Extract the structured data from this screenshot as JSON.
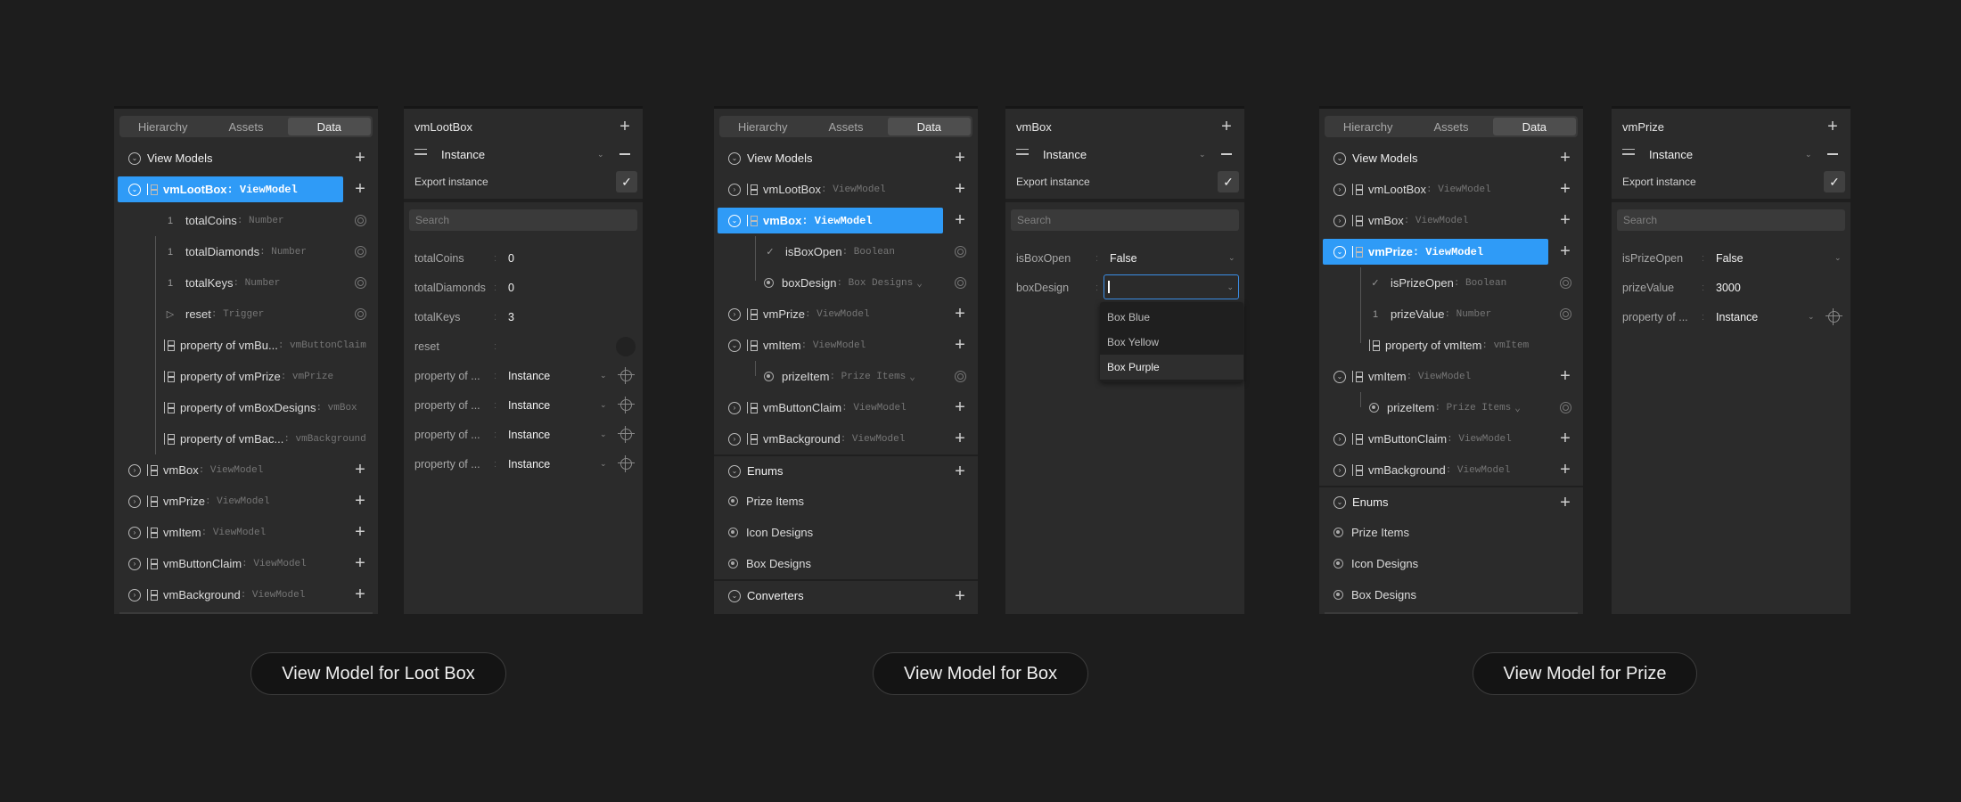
{
  "tabs": {
    "hierarchy": "Hierarchy",
    "assets": "Assets",
    "data": "Data"
  },
  "common": {
    "view_models": "View Models",
    "enums": "Enums",
    "converters": "Converters",
    "instance": "Instance",
    "export_instance": "Export instance",
    "search_placeholder": "Search",
    "property_of": "property of ...",
    "accent": "#2f9bf7"
  },
  "captions": [
    "View Model for Loot Box",
    "View Model for Box",
    "View Model for Prize"
  ],
  "panel1": {
    "selected": {
      "name": "vmLootBox",
      "type": ": ViewModel"
    },
    "children": [
      {
        "icon": "1",
        "name": "totalCoins",
        "type": ": Number"
      },
      {
        "icon": "1",
        "name": "totalDiamonds",
        "type": ": Number"
      },
      {
        "icon": "1",
        "name": "totalKeys",
        "type": ": Number"
      },
      {
        "icon": "▷",
        "name": "reset",
        "type": ": Trigger"
      },
      {
        "name": "property of vmBu...",
        "type": ": vmButtonClaim"
      },
      {
        "name": "property of vmPrize",
        "type": ": vmPrize"
      },
      {
        "name": "property of vmBoxDesigns",
        "type": ": vmBox"
      },
      {
        "name": "property of vmBac...",
        "type": ": vmBackground"
      }
    ],
    "others": [
      {
        "name": "vmBox",
        "type": ": ViewModel"
      },
      {
        "name": "vmPrize",
        "type": ": ViewModel"
      },
      {
        "name": "vmItem",
        "type": ": ViewModel"
      },
      {
        "name": "vmButtonClaim",
        "type": ": ViewModel"
      },
      {
        "name": "vmBackground",
        "type": ": ViewModel"
      }
    ],
    "title": "vmLootBox",
    "props": [
      {
        "label": "totalCoins",
        "value": "0"
      },
      {
        "label": "totalDiamonds",
        "value": "0"
      },
      {
        "label": "totalKeys",
        "value": "3"
      },
      {
        "label": "reset",
        "value": ""
      },
      {
        "label": "property of ...",
        "value": "Instance"
      },
      {
        "label": "property of ...",
        "value": "Instance"
      },
      {
        "label": "property of ...",
        "value": "Instance"
      },
      {
        "label": "property of ...",
        "value": "Instance"
      }
    ]
  },
  "panel2": {
    "vm": [
      {
        "name": "vmLootBox",
        "type": ": ViewModel"
      },
      {
        "name": "vmBox",
        "type": ": ViewModel"
      },
      {
        "name": "isBoxOpen",
        "type": ": Boolean"
      },
      {
        "name": "boxDesign",
        "type": ": Box Designs"
      },
      {
        "name": "vmPrize",
        "type": ": ViewModel"
      },
      {
        "name": "vmItem",
        "type": ": ViewModel"
      },
      {
        "name": "prizeItem",
        "type": ": Prize Items"
      },
      {
        "name": "vmButtonClaim",
        "type": ": ViewModel"
      },
      {
        "name": "vmBackground",
        "type": ": ViewModel"
      }
    ],
    "enums": [
      "Prize Items",
      "Icon Designs",
      "Box Designs"
    ],
    "title": "vmBox",
    "props": [
      {
        "label": "isBoxOpen",
        "value": "False"
      },
      {
        "label": "boxDesign",
        "value": ""
      }
    ],
    "menu": [
      "Box Blue",
      "Box Yellow",
      "Box Purple"
    ]
  },
  "panel3": {
    "vm": [
      {
        "name": "vmLootBox",
        "type": ": ViewModel"
      },
      {
        "name": "vmBox",
        "type": ": ViewModel"
      },
      {
        "name": "vmPrize",
        "type": ": ViewModel"
      },
      {
        "name": "isPrizeOpen",
        "type": ": Boolean"
      },
      {
        "name": "prizeValue",
        "type": ": Number"
      },
      {
        "name": "property of vmItem",
        "type": ": vmItem"
      },
      {
        "name": "vmItem",
        "type": ": ViewModel"
      },
      {
        "name": "prizeItem",
        "type": ": Prize Items"
      },
      {
        "name": "vmButtonClaim",
        "type": ": ViewModel"
      },
      {
        "name": "vmBackground",
        "type": ": ViewModel"
      }
    ],
    "enums": [
      "Prize Items",
      "Icon Designs",
      "Box Designs"
    ],
    "title": "vmPrize",
    "props": [
      {
        "label": "isPrizeOpen",
        "value": "False"
      },
      {
        "label": "prizeValue",
        "value": "3000"
      },
      {
        "label": "property of ...",
        "value": "Instance"
      }
    ]
  }
}
